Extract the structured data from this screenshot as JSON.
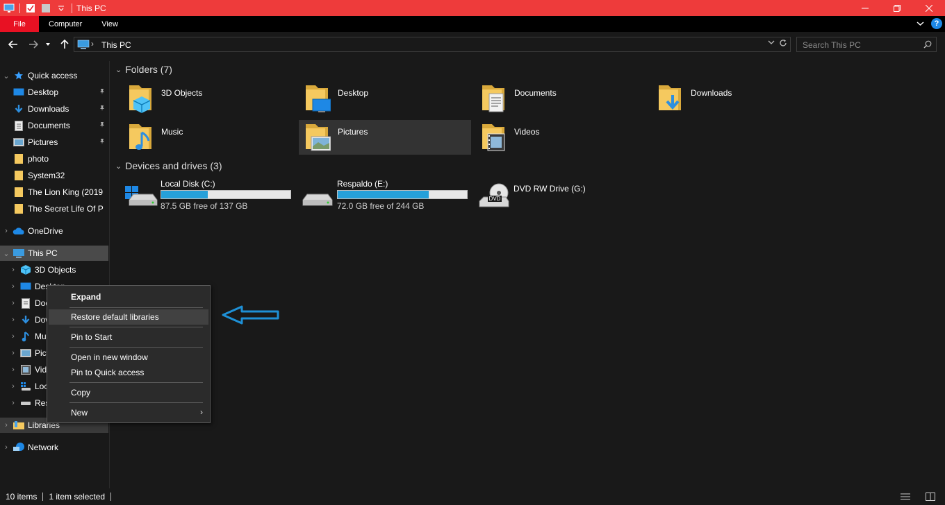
{
  "window": {
    "title": "This PC",
    "title_bar_color": "#ee3b3b"
  },
  "ribbon": {
    "tabs": [
      "File",
      "Computer",
      "View"
    ],
    "file_tab_color": "#e81123",
    "help_label": "?"
  },
  "address_bar": {
    "path": "This PC",
    "separator": "›"
  },
  "search": {
    "placeholder": "Search This PC"
  },
  "nav_pane": {
    "quick_access": {
      "label": "Quick access",
      "items": [
        {
          "label": "Desktop",
          "icon": "desktop-icon",
          "pinned": true
        },
        {
          "label": "Downloads",
          "icon": "download-arrow-icon",
          "pinned": true
        },
        {
          "label": "Documents",
          "icon": "document-icon",
          "pinned": true
        },
        {
          "label": "Pictures",
          "icon": "picture-icon",
          "pinned": true
        },
        {
          "label": "photo",
          "icon": "folder-icon",
          "pinned": false
        },
        {
          "label": "System32",
          "icon": "folder-icon",
          "pinned": false
        },
        {
          "label": "The Lion King (2019",
          "icon": "folder-icon",
          "pinned": false
        },
        {
          "label": "The Secret Life Of P",
          "icon": "folder-icon",
          "pinned": false
        }
      ]
    },
    "onedrive": {
      "label": "OneDrive"
    },
    "this_pc": {
      "label": "This PC",
      "children": [
        {
          "label": "3D Objects",
          "icon": "cube-icon"
        },
        {
          "label": "Desktop",
          "icon": "desktop-icon"
        },
        {
          "label": "Documents",
          "icon": "document-icon"
        },
        {
          "label": "Downloads",
          "icon": "download-arrow-icon"
        },
        {
          "label": "Music",
          "icon": "music-note-icon"
        },
        {
          "label": "Pictures",
          "icon": "picture-icon"
        },
        {
          "label": "Videos",
          "icon": "film-icon"
        },
        {
          "label": "Local Disk (C:)",
          "icon": "windows-drive-icon"
        },
        {
          "label": "Respaldo (E:)",
          "icon": "drive-icon"
        }
      ]
    },
    "libraries": {
      "label": "Libraries"
    },
    "network": {
      "label": "Network"
    }
  },
  "content": {
    "folders_header": "Folders (7)",
    "folders": [
      {
        "name": "3D Objects",
        "icon": "cube-folder-icon"
      },
      {
        "name": "Desktop",
        "icon": "desktop-folder-icon"
      },
      {
        "name": "Documents",
        "icon": "documents-folder-icon"
      },
      {
        "name": "Downloads",
        "icon": "downloads-folder-icon"
      },
      {
        "name": "Music",
        "icon": "music-folder-icon"
      },
      {
        "name": "Pictures",
        "icon": "pictures-folder-icon",
        "highlighted": true
      },
      {
        "name": "Videos",
        "icon": "videos-folder-icon"
      }
    ],
    "drives_header": "Devices and drives (3)",
    "drives": [
      {
        "name": "Local Disk (C:)",
        "free_text": "87.5 GB free of 137 GB",
        "used_fraction": 0.36
      },
      {
        "name": "Respaldo (E:)",
        "free_text": "72.0 GB free of 244 GB",
        "used_fraction": 0.705
      },
      {
        "name": "DVD RW Drive (G:)",
        "disc_label": "DVD"
      }
    ]
  },
  "context_menu": {
    "items": [
      "Expand",
      "Restore default libraries",
      "Pin to Start",
      "Open in new window",
      "Pin to Quick access",
      "Copy",
      "New"
    ],
    "submenu_glyph": "›"
  },
  "status_bar": {
    "item_count": "10 items",
    "selection": "1 item selected"
  },
  "colors": {
    "folder_yellow": "#f5c95f",
    "accent_blue": "#26a0da",
    "annotation_arrow": "#1e90d6"
  }
}
